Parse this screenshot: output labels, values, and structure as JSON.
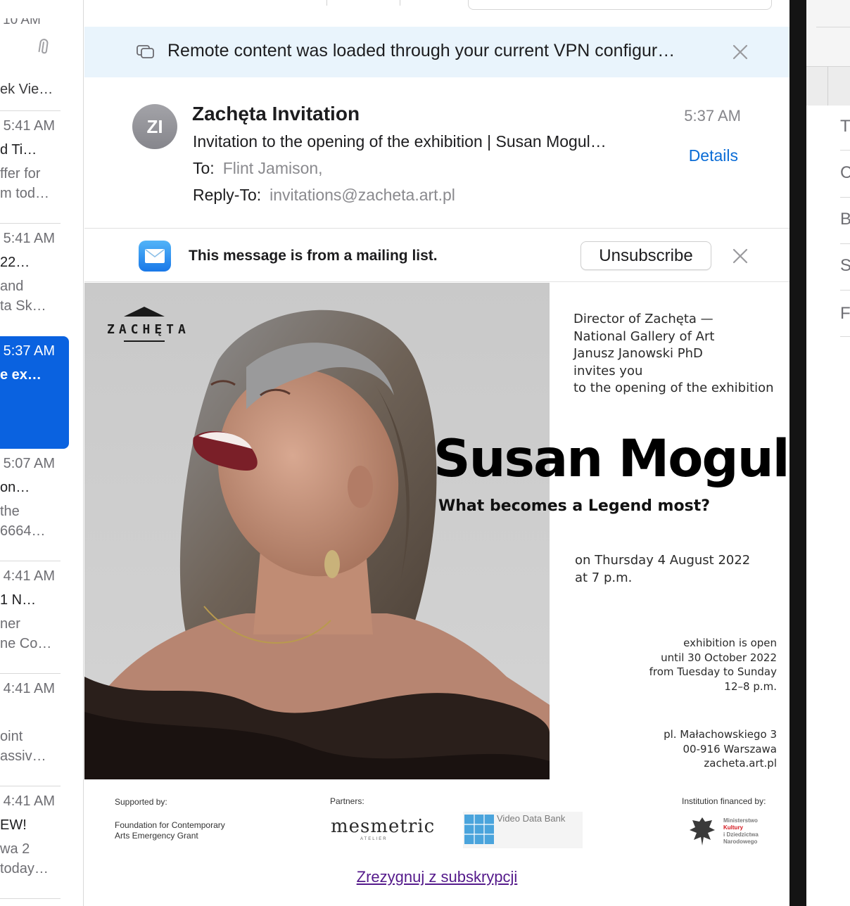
{
  "message_list": {
    "top_fragment": "10 AM",
    "first_tail": "ek Vie…",
    "items": [
      {
        "time": "5:41 AM",
        "subject": "d Ti…",
        "preview1": "ffer for",
        "preview2": "m tod…"
      },
      {
        "time": "5:41 AM",
        "subject": "22…",
        "preview1": "and",
        "preview2": "ta Sk…"
      },
      {
        "time": "5:37 AM",
        "subject": "e ex…",
        "preview1": "",
        "preview2": "",
        "selected": true
      },
      {
        "time": "5:07 AM",
        "subject": "on…",
        "preview1": "the",
        "preview2": "6664…"
      },
      {
        "time": "4:41 AM",
        "subject": "1 N…",
        "preview1": "ner",
        "preview2": "ne Co…"
      },
      {
        "time": "4:41 AM",
        "subject": "",
        "preview1": "oint",
        "preview2": "assiv…"
      },
      {
        "time": "4:41 AM",
        "subject": "EW!",
        "preview1": "wa 2",
        "preview2": "today…"
      }
    ]
  },
  "vpn_banner": {
    "text": "Remote content was loaded through your current VPN configur…",
    "icon": "remote-content-icon",
    "close_icon": "close-icon"
  },
  "header": {
    "avatar_initials": "ZI",
    "sender": "Zachęta Invitation",
    "subject": "Invitation to the opening of the exhibition | Susan Mogul…",
    "to_label": "To:",
    "to_value": "Flint Jamison,",
    "reply_to_label": "Reply-To:",
    "reply_to_value": "invitations@zacheta.art.pl",
    "time": "5:37 AM",
    "details_label": "Details"
  },
  "mailing_list": {
    "text": "This message is from a mailing list.",
    "unsubscribe_label": "Unsubscribe",
    "icon": "mail-envelope-icon"
  },
  "poster": {
    "logo_text": "ZACHĘTA",
    "invite_lines": [
      "Director of Zachęta —",
      "National Gallery of Art",
      "Janusz Janowski PhD",
      "invites you",
      "to the opening of the exhibition"
    ],
    "artist": "Susan Mogul",
    "tagline": "What becomes a Legend most?",
    "when_lines": [
      "on Thursday 4 August 2022",
      "at 7 p.m."
    ],
    "open_lines": [
      "exhibition is open",
      "until 30 October 2022",
      "from Tuesday to Sunday",
      "12–8 p.m."
    ],
    "address_lines": [
      "pl. Małachowskiego 3",
      "00-916 Warszawa",
      "zacheta.art.pl"
    ]
  },
  "sponsors": {
    "supported_label": "Supported by:",
    "supported_lines": [
      "Foundation for Contemporary",
      "Arts Emergency Grant"
    ],
    "partners_label": "Partners:",
    "mesmetric": "mesmetric",
    "mesmetric_sub": "ATELIER",
    "vdb_name": "Video Data Bank",
    "financed_label": "Institution financed by:",
    "ministry_lines": [
      "Ministerstwo",
      "Kultury",
      "i Dziedzictwa",
      "Narodowego"
    ]
  },
  "unsubscribe_link": "Zrezygnuj z subskrypcji",
  "right_pane": {
    "letters": [
      "T",
      "C",
      "B",
      "S",
      "F"
    ]
  }
}
